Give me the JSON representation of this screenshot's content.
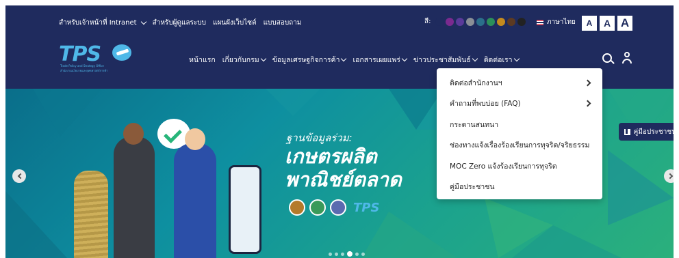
{
  "topbar": {
    "links": [
      {
        "label": "สำหรับเจ้าหน้าที่ Intranet",
        "has_dropdown": true
      },
      {
        "label": "สำหรับผู้ดูแลระบบ",
        "has_dropdown": false
      },
      {
        "label": "แผนผังเว็บไซต์",
        "has_dropdown": false
      },
      {
        "label": "แบบสอบถาม",
        "has_dropdown": false
      }
    ],
    "color_label": "สี:",
    "swatches": [
      "#1f2b5e",
      "#7a2a8f",
      "#5a3a9a",
      "#8a8f96",
      "#2b6f8a",
      "#2c8f5a",
      "#c48a1e",
      "#5c3a22",
      "#222222"
    ],
    "language": "ภาษาไทย",
    "font_size_buttons": [
      "A",
      "A",
      "A"
    ]
  },
  "logo": {
    "text": "TPS",
    "line1": "Trade Policy and Strategy Office",
    "line2": "สำนักงานนโยบายและยุทธศาสตร์การค้า"
  },
  "nav": {
    "items": [
      {
        "label": "หน้าแรก",
        "has_dropdown": false
      },
      {
        "label": "เกี่ยวกับกรม",
        "has_dropdown": true
      },
      {
        "label": "ข้อมูลเศรษฐกิจการค้า",
        "has_dropdown": true
      },
      {
        "label": "เอกสารเผยแพร่",
        "has_dropdown": true
      },
      {
        "label": "ข่าวประชาสัมพันธ์",
        "has_dropdown": true
      },
      {
        "label": "ติดต่อเรา",
        "has_dropdown": true
      }
    ]
  },
  "dropdown": {
    "items": [
      {
        "label": "ติดต่อสำนักงานฯ",
        "has_submenu": true
      },
      {
        "label": "คำถามที่พบบ่อย (FAQ)",
        "has_submenu": true
      },
      {
        "label": "กระดานสนทนา",
        "has_submenu": false
      },
      {
        "label": "ช่องทางแจ้งเรื่องร้องเรียนการทุจริต/จริยธรรม",
        "has_submenu": false
      },
      {
        "label": "MOC Zero แจ้งร้องเรียนการทุจริต",
        "has_submenu": false
      },
      {
        "label": "คู่มือประชาชน",
        "has_submenu": false
      }
    ]
  },
  "hero": {
    "subtitle": "ฐานข้อมูลร่วม:",
    "title_line1": "เกษตรผลิต",
    "title_line2": "พาณิชย์ตลาด",
    "logo_text": "TPS",
    "slide_count": 6,
    "active_slide": 3
  },
  "manual_button": {
    "label": "คู่มือประชาชน"
  }
}
